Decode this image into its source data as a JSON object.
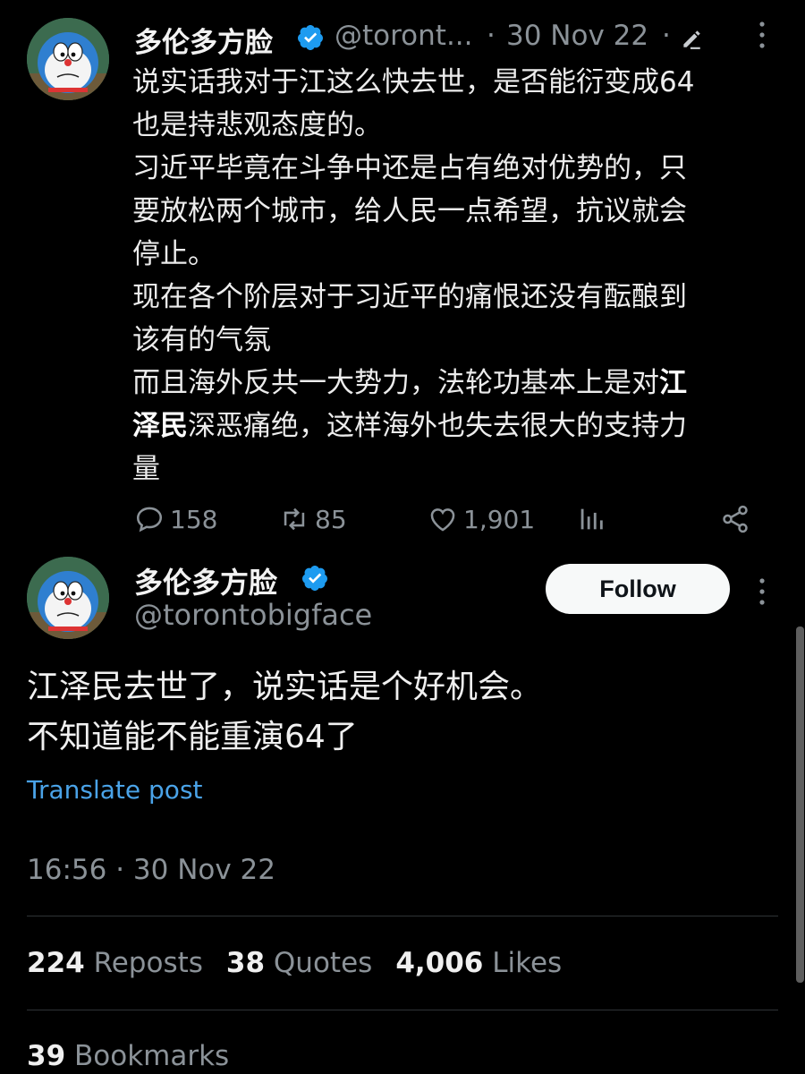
{
  "tweet1": {
    "display_name": "多伦多方脸",
    "handle": "@toront...",
    "separator": "·",
    "date": "30 Nov 22",
    "lines": [
      [
        "说实话我对于江这么快去世，是否能衍变成64"
      ],
      [
        "也是持悲观态度的。"
      ],
      [
        "习近平毕竟在斗争中还是占有绝对优势的，只"
      ],
      [
        "要放松两个城市，给人民一点希望，抗议就会"
      ],
      [
        "停止。"
      ],
      [
        "现在各个阶层对于习近平的痛恨还没有酝酿到"
      ],
      [
        "该有的气氛"
      ],
      [
        "而且海外反共一大势力，法轮功基本上是对",
        "江"
      ],
      [
        "泽民",
        "深恶痛绝，这样海外也失去很大的支持力"
      ],
      [
        "量"
      ]
    ],
    "actions": {
      "replies": "158",
      "reposts": "85",
      "likes": "1,901"
    }
  },
  "tweet2": {
    "display_name": "多伦多方脸",
    "handle": "@torontobigface",
    "follow_label": "Follow",
    "lines": [
      "江泽民去世了，说实话是个好机会。",
      "不知道能不能重演64了"
    ],
    "translate_label": "Translate post",
    "timestamp": "16:56 · 30 Nov 22",
    "stats": {
      "reposts_count": "224",
      "reposts_label": "Reposts",
      "quotes_count": "38",
      "quotes_label": "Quotes",
      "likes_count": "4,006",
      "likes_label": "Likes",
      "bookmarks_count": "39",
      "bookmarks_label": "Bookmarks"
    }
  },
  "icons": {
    "verified": "verified-badge-icon",
    "edit": "edit-pencil-icon",
    "more": "more-vertical-icon",
    "reply": "reply-bubble-icon",
    "repost": "repost-arrows-icon",
    "like": "heart-icon",
    "views": "analytics-bars-icon",
    "share": "share-icon"
  },
  "colors": {
    "background": "#000000",
    "verified": "#1d9bf0",
    "link": "#4aa3e8",
    "muted": "#8b9298"
  }
}
